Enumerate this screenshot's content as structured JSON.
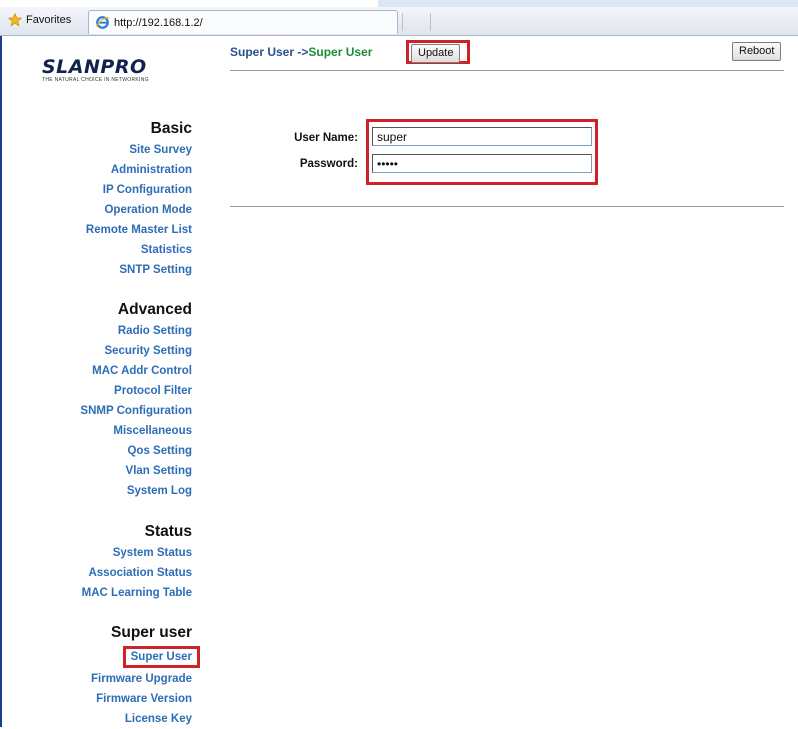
{
  "browser": {
    "favorites_label": "Favorites",
    "tab_url": "http://192.168.1.2/"
  },
  "brand": {
    "logo_text": "SLANPRO",
    "tagline": "THE NATURAL CHOICE IN NETWORKING"
  },
  "sidebar": {
    "basic": {
      "heading": "Basic",
      "items": [
        "Site Survey",
        "Administration",
        "IP Configuration",
        "Operation Mode",
        "Remote Master List",
        "Statistics",
        "SNTP Setting"
      ]
    },
    "advanced": {
      "heading": "Advanced",
      "items": [
        "Radio Setting",
        "Security Setting",
        "MAC Addr Control",
        "Protocol Filter",
        "SNMP Configuration",
        "Miscellaneous",
        "Qos Setting",
        "Vlan Setting",
        "System Log"
      ]
    },
    "status": {
      "heading": "Status",
      "items": [
        "System Status",
        "Association Status",
        "MAC Learning Table"
      ]
    },
    "superuser": {
      "heading": "Super user",
      "items": [
        "Super User",
        "Firmware Upgrade",
        "Firmware Version",
        "License Key"
      ]
    }
  },
  "main": {
    "breadcrumb_parent": "Super User ->",
    "breadcrumb_current": "Super User",
    "update_label": "Update",
    "reboot_label": "Reboot",
    "username_label": "User Name:",
    "username_value": "super",
    "password_label": "Password:",
    "password_value": "12345"
  },
  "colors": {
    "highlight": "#cc2229",
    "nav_link": "#2d6db6",
    "breadcrumb_current": "#1e8b3a"
  }
}
